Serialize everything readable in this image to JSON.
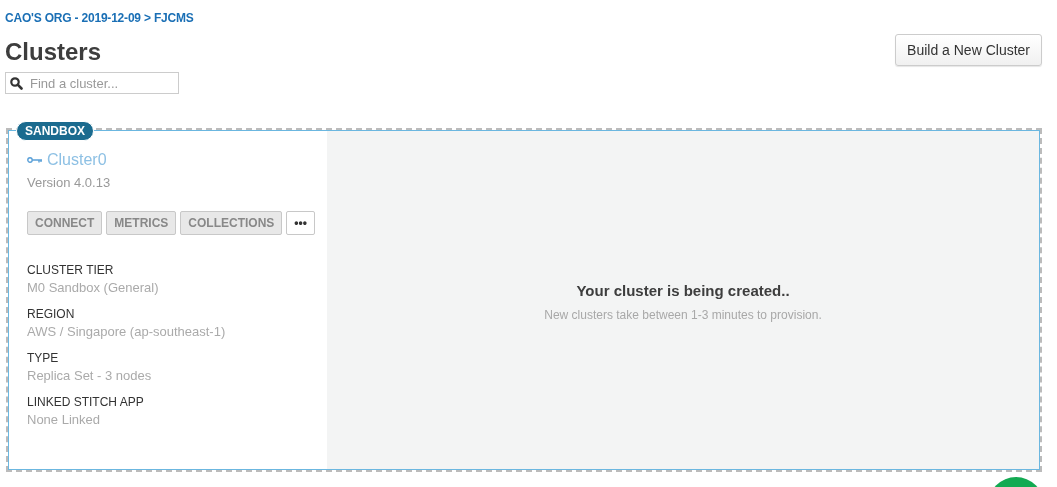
{
  "breadcrumb": "CAO'S ORG - 2019-12-09 > FJCMS",
  "title": "Clusters",
  "build_button": "Build a New Cluster",
  "search": {
    "placeholder": "Find a cluster..."
  },
  "cluster": {
    "badge": "SANDBOX",
    "name": "Cluster0",
    "version": "Version 4.0.13",
    "actions": [
      "CONNECT",
      "METRICS",
      "COLLECTIONS",
      "•••"
    ],
    "details": [
      {
        "label": "CLUSTER TIER",
        "value": "M0 Sandbox (General)"
      },
      {
        "label": "REGION",
        "value": "AWS / Singapore (ap-southeast-1)"
      },
      {
        "label": "TYPE",
        "value": "Replica Set - 3 nodes"
      },
      {
        "label": "LINKED STITCH APP",
        "value": "None Linked"
      }
    ],
    "status_title": "Your cluster is being created..",
    "status_note": "New clusters take between 1-3 minutes to provision."
  }
}
